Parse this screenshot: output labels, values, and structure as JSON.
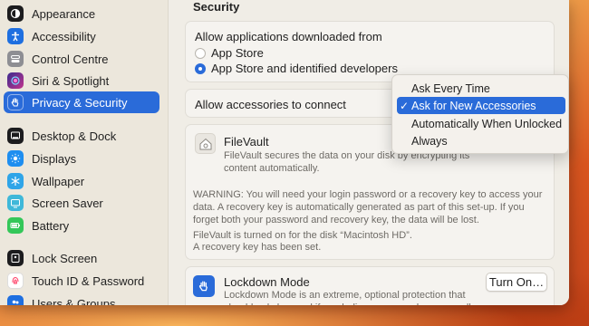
{
  "sidebar": {
    "items": [
      {
        "label": "Appearance",
        "icon": "appearance-icon",
        "color": "#1c1c1e"
      },
      {
        "label": "Accessibility",
        "icon": "accessibility-icon",
        "color": "#1e6fe0"
      },
      {
        "label": "Control Centre",
        "icon": "control-centre-icon",
        "color": "#8e8e93"
      },
      {
        "label": "Siri & Spotlight",
        "icon": "siri-icon",
        "color": "#7a3fd6"
      },
      {
        "label": "Privacy & Security",
        "icon": "hand-icon",
        "color": "#2a6bd9",
        "active": true
      },
      {
        "label": "Desktop & Dock",
        "icon": "dock-icon",
        "color": "#1c1c1e"
      },
      {
        "label": "Displays",
        "icon": "sun-icon",
        "color": "#1e8ef0"
      },
      {
        "label": "Wallpaper",
        "icon": "snowflake-icon",
        "color": "#2fa5e8"
      },
      {
        "label": "Screen Saver",
        "icon": "screen-saver-icon",
        "color": "#3fb8d9"
      },
      {
        "label": "Battery",
        "icon": "battery-icon",
        "color": "#34c759"
      },
      {
        "label": "Lock Screen",
        "icon": "lock-screen-icon",
        "color": "#1c1c1e"
      },
      {
        "label": "Touch ID & Password",
        "icon": "fingerprint-icon",
        "color": "#ff3b63"
      },
      {
        "label": "Users & Groups",
        "icon": "users-icon",
        "color": "#1e6fe0"
      }
    ]
  },
  "main": {
    "section_title": "Security",
    "downloads": {
      "heading": "Allow applications downloaded from",
      "options": [
        "App Store",
        "App Store and identified developers"
      ],
      "selected": 1
    },
    "accessories": {
      "label": "Allow accessories to connect"
    },
    "filevault": {
      "title": "FileVault",
      "description": "FileVault secures the data on your disk by encrypting its content automatically.",
      "warning": "WARNING: You will need your login password or a recovery key to access your data. A recovery key is automatically generated as part of this set-up. If you forget both your password and recovery key, the data will be lost.",
      "status_line1": "FileVault is turned on for the disk “Macintosh HD”.",
      "status_line2": "A recovery key has been set."
    },
    "lockdown": {
      "title": "Lockdown Mode",
      "button": "Turn On…",
      "description": "Lockdown Mode is an extreme, optional protection that should only be used if you believe you may be personally"
    }
  },
  "dropdown_menu": {
    "items": [
      "Ask Every Time",
      "Ask for New Accessories",
      "Automatically When Unlocked",
      "Always"
    ],
    "selected_index": 1,
    "check_glyph": "✓"
  },
  "colors": {
    "accent": "#2a6bd9"
  }
}
